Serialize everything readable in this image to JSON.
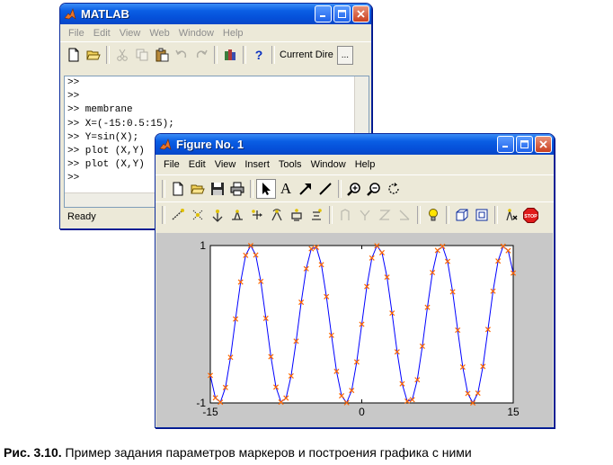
{
  "matlab": {
    "title": "MATLAB",
    "menu": [
      "File",
      "Edit",
      "View",
      "Web",
      "Window",
      "Help"
    ],
    "current_dir_label": "Current Dire",
    "browse_label": "...",
    "help_label": "?",
    "command_lines": [
      ">>",
      ">>",
      ">> membrane",
      ">> X=(-15:0.5:15);",
      ">> Y=sin(X);",
      ">> plot (X,Y)",
      ">> plot (X,Y)",
      ">>"
    ],
    "status": "Ready"
  },
  "figure": {
    "title": "Figure No. 1",
    "menu": [
      "File",
      "Edit",
      "View",
      "Insert",
      "Tools",
      "Window",
      "Help"
    ],
    "text_tool_label": "A",
    "stop_label": "STOP"
  },
  "chart_data": {
    "type": "line",
    "function": "y = sin(x)",
    "x_start": -15,
    "x_end": 15,
    "x_step": 0.5,
    "xlim": [
      -15,
      15
    ],
    "ylim": [
      -1,
      1
    ],
    "x_ticks": [
      "-15",
      "0",
      "15"
    ],
    "y_ticks": [
      "1",
      "-1"
    ],
    "line_color": "#0000ff",
    "marker_color": "#ff6600",
    "marker": "x",
    "grid": false
  },
  "caption": {
    "label": "Рис. 3.10.",
    "text": " Пример задания параметров маркеров и построения графика с ними"
  }
}
